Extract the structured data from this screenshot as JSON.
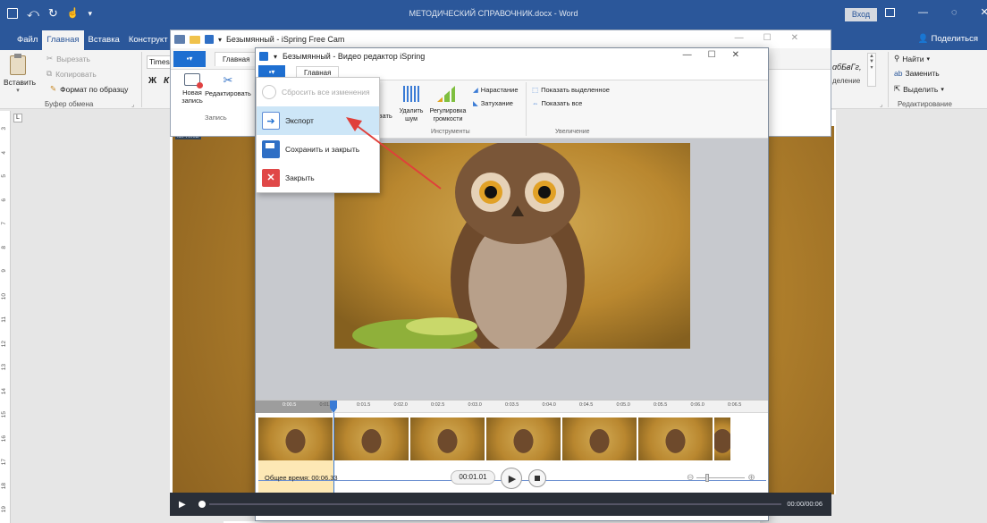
{
  "word": {
    "title": "МЕТОДИЧЕСКИЙ СПРАВОЧНИК.docx - Word",
    "signin": "Вход",
    "share": "Поделиться",
    "tabs": [
      "Файл",
      "Главная",
      "Вставка",
      "Конструкт"
    ],
    "clipboard": {
      "paste": "Вставить",
      "cut": "Вырезать",
      "copy": "Копировать",
      "format_painter": "Формат по образцу",
      "group": "Буфер обмена"
    },
    "font_name": "Times",
    "bold": "Ж",
    "italic": "К",
    "style_preview": "ɑбБвГг,",
    "highlight_fragment": "деление",
    "editing": {
      "find": "Найти",
      "replace": "Заменить",
      "select": "Выделить",
      "group": "Редактирование"
    },
    "ruler_numbers": [
      "3",
      "4",
      "5",
      "6",
      "7",
      "8",
      "9",
      "10",
      "11",
      "12",
      "13",
      "14",
      "15",
      "16",
      "17",
      "18",
      "19"
    ],
    "doc_label": "ISPRING"
  },
  "cam": {
    "title": "Безымянный - iSpring Free Cam",
    "tab": "Главная",
    "new_record": "Новая запись",
    "edit": "Редактировать",
    "group": "Запись"
  },
  "editor": {
    "title": "Безымянный - Видео редактор iSpring",
    "tab": "Главная",
    "trim_fragment": "зать",
    "noise": "Удалить шум",
    "volume": "Регулировка громкости",
    "fade_in": "Нарастание",
    "fade_out": "Затухание",
    "show_selected": "Показать выделенное",
    "show_all": "Показать все",
    "group_tools": "Инструменты",
    "group_zoom": "Увеличение",
    "ticks": [
      "0:00.5",
      "0:01.0",
      "0:01.5",
      "0:02.0",
      "0:02.5",
      "0:03.0",
      "0:03.5",
      "0:04.0",
      "0:04.5",
      "0:05.0",
      "0:05.5",
      "0:06.0",
      "0:06.5"
    ],
    "total_label": "Общее время: 00:06.33",
    "time_current": "00:01.01",
    "player_time": "00:00/00:06"
  },
  "menu": {
    "items": [
      {
        "label": "Сбросить все изменения",
        "disabled": true
      },
      {
        "label": "Экспорт",
        "highlighted": true
      },
      {
        "label": "Сохранить и закрыть"
      },
      {
        "label": "Закрыть"
      }
    ]
  },
  "colors": {
    "word_blue": "#2b579a",
    "ispring_blue": "#1e6fd1",
    "arrow_red": "#e0403a",
    "menu_highlight": "#cde6f7"
  }
}
